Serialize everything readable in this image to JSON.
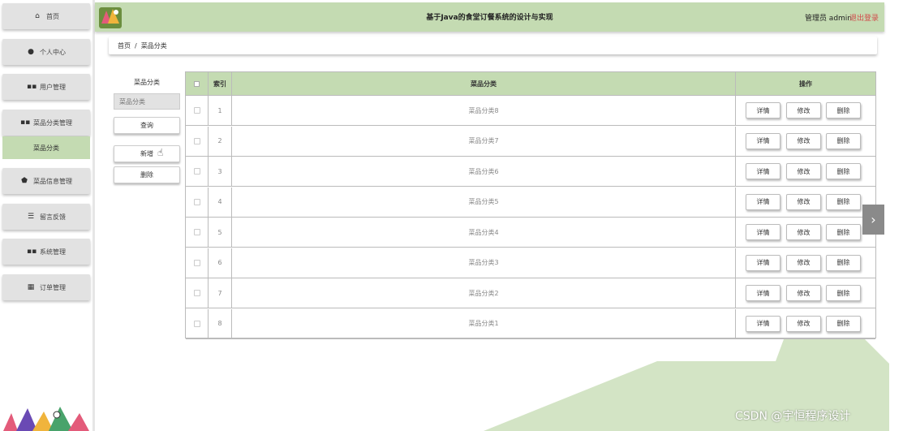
{
  "header": {
    "title": "基于Java的食堂订餐系统的设计与实现",
    "user_label": "管理员 admin",
    "logout_label": "退出登录"
  },
  "sidebar": {
    "items": [
      {
        "label": "首页",
        "icon": "home-icon"
      },
      {
        "label": "个人中心",
        "icon": "user-icon"
      },
      {
        "label": "用户管理",
        "icon": "grid-icon"
      },
      {
        "label": "菜品分类管理",
        "icon": "grid-icon"
      },
      {
        "label": "菜品信息管理",
        "icon": "shield-icon"
      },
      {
        "label": "留言反馈",
        "icon": "sliders-icon"
      },
      {
        "label": "系统管理",
        "icon": "grid-icon"
      },
      {
        "label": "订单管理",
        "icon": "table-icon"
      }
    ],
    "sub_item": "菜品分类"
  },
  "breadcrumb": {
    "home": "首页",
    "separator": "/",
    "current": "菜品分类"
  },
  "actions": {
    "title": "菜品分类",
    "search_placeholder": "菜品分类",
    "query_label": "查询",
    "add_label": "新增",
    "delete_label": "删除"
  },
  "table": {
    "headers": {
      "index": "索引",
      "name": "菜品分类",
      "ops": "操作"
    },
    "rows": [
      {
        "index": "1",
        "name": "菜品分类8"
      },
      {
        "index": "2",
        "name": "菜品分类7"
      },
      {
        "index": "3",
        "name": "菜品分类6"
      },
      {
        "index": "4",
        "name": "菜品分类5"
      },
      {
        "index": "5",
        "name": "菜品分类4"
      },
      {
        "index": "6",
        "name": "菜品分类3"
      },
      {
        "index": "7",
        "name": "菜品分类2"
      },
      {
        "index": "8",
        "name": "菜品分类1"
      }
    ],
    "op_labels": {
      "detail": "详情",
      "edit": "修改",
      "delete": "删除"
    }
  },
  "watermark": "CSDN @宇恒程序设计",
  "colors": {
    "accent": "#c4dbb2",
    "nav": "#e2e2e2",
    "logout": "#d24b4b"
  }
}
